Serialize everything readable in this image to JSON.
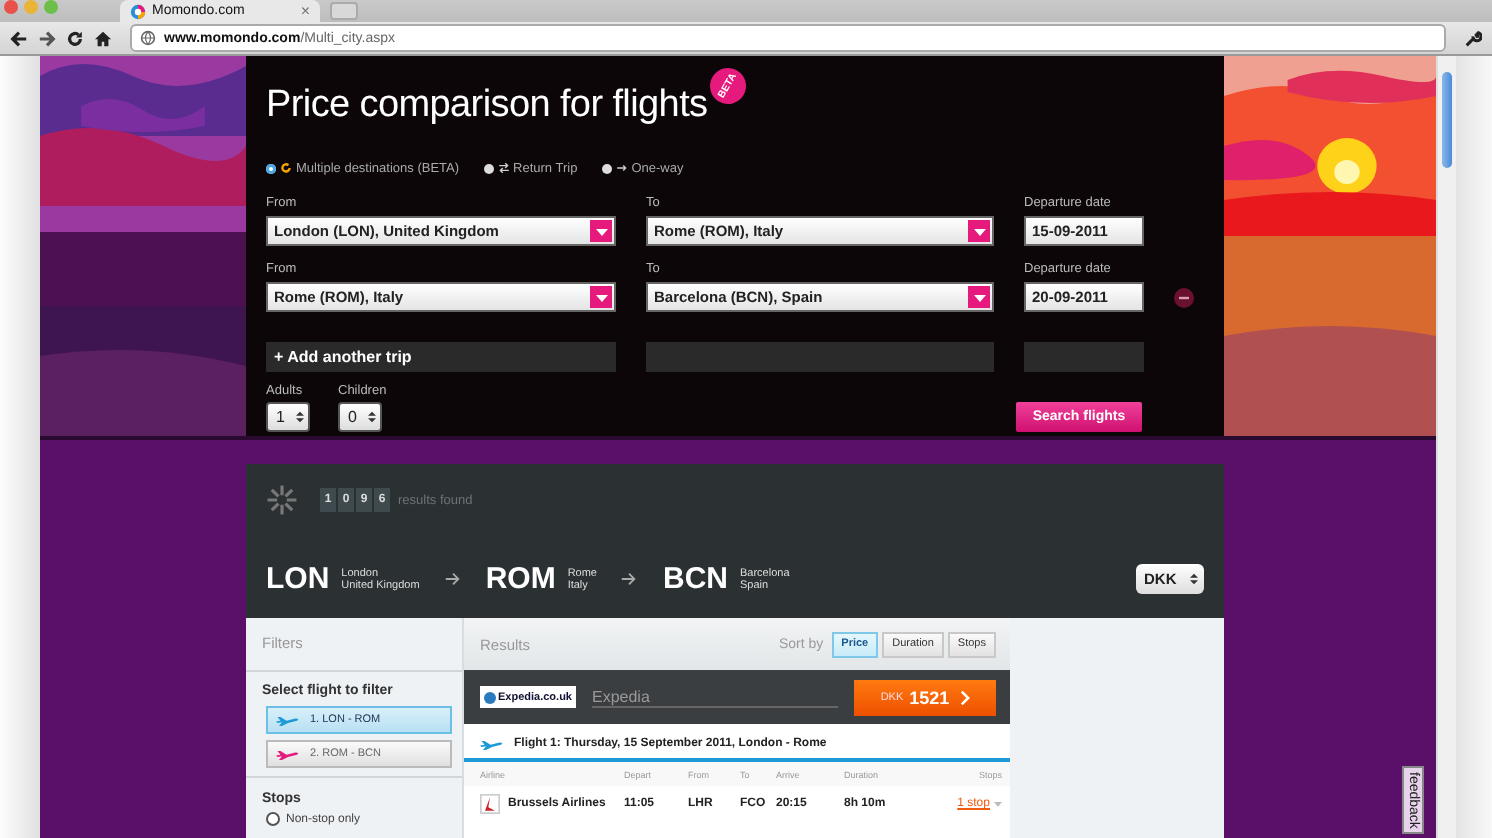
{
  "browser": {
    "tab": {
      "title": "Momondo.com",
      "close": "×"
    },
    "address": {
      "domain": "www.momondo.com",
      "path": "/Multi_city.aspx"
    }
  },
  "search": {
    "title": "Price comparison for flights",
    "badge": "BETA",
    "trip_types": [
      {
        "label": "Multiple destinations (BETA)",
        "selected": true,
        "kind": "multi"
      },
      {
        "label": "Return Trip",
        "selected": false,
        "kind": "return"
      },
      {
        "label": "One-way",
        "selected": false,
        "kind": "oneway"
      }
    ],
    "legs": [
      {
        "from_label": "From",
        "from": "London (LON), United Kingdom",
        "to_label": "To",
        "to": "Rome (ROM), Italy",
        "date_label": "Departure date",
        "date": "15-09-2011",
        "removable": false
      },
      {
        "from_label": "From",
        "from": "Rome (ROM), Italy",
        "to_label": "To",
        "to": "Barcelona (BCN), Spain",
        "date_label": "Departure date",
        "date": "20-09-2011",
        "removable": true
      }
    ],
    "add_trip": "+ Add another trip",
    "adults": {
      "label": "Adults",
      "value": "1"
    },
    "children": {
      "label": "Children",
      "value": "0"
    },
    "submit": "Search flights"
  },
  "summary": {
    "digits": [
      "1",
      "0",
      "9",
      "6"
    ],
    "text": "results found",
    "route": [
      {
        "code": "LON",
        "city": "London",
        "country": "United Kingdom"
      },
      {
        "code": "ROM",
        "city": "Rome",
        "country": "Italy"
      },
      {
        "code": "BCN",
        "city": "Barcelona",
        "country": "Spain"
      }
    ],
    "currency": "DKK"
  },
  "filters": {
    "title": "Filters",
    "flight_heading": "Select flight to filter",
    "flights": [
      {
        "label": "1. LON - ROM",
        "selected": true,
        "color": "#1e9ad6"
      },
      {
        "label": "2. ROM - BCN",
        "selected": false,
        "color": "#e6197d"
      }
    ],
    "stops_heading": "Stops",
    "stop_options": [
      {
        "label": "Non-stop only",
        "selected": false
      }
    ]
  },
  "results": {
    "title": "Results",
    "sort_label": "Sort by",
    "sort_options": [
      {
        "label": "Price",
        "selected": true
      },
      {
        "label": "Duration",
        "selected": false
      },
      {
        "label": "Stops",
        "selected": false
      }
    ],
    "offer": {
      "logo": "Expedia.co.uk",
      "provider": "Expedia",
      "currency": "DKK",
      "price": "1521"
    },
    "flight_heading": "Flight 1: Thursday, 15 September 2011, London - Rome",
    "columns": [
      "Airline",
      "Depart",
      "From",
      "To",
      "Arrive",
      "Duration",
      "Stops"
    ],
    "rows": [
      {
        "airline": "Brussels Airlines",
        "depart": "11:05",
        "from": "LHR",
        "to": "FCO",
        "arrive": "20:15",
        "duration": "8h 10m",
        "stops": "1 stop"
      }
    ]
  },
  "feedback": "feedback"
}
